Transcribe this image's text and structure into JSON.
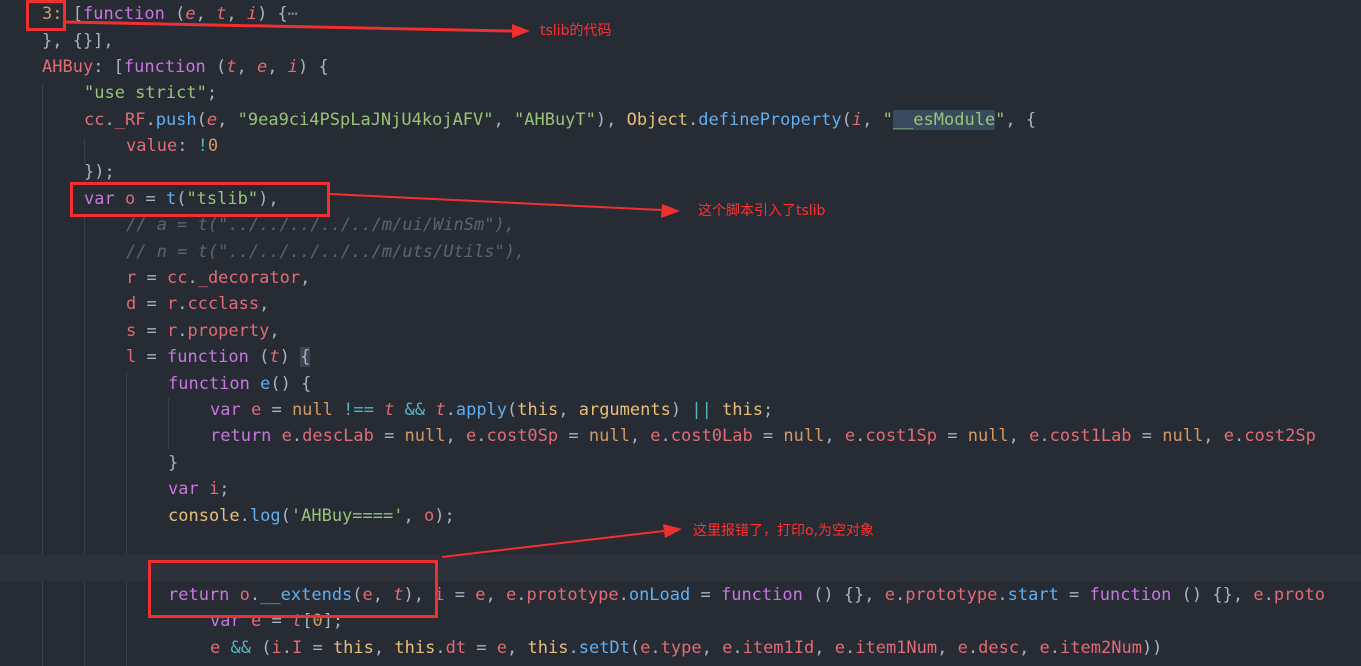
{
  "code_lines": [
    "3: [function (e, t, i) {⋯",
    "}, {}],",
    "AHBuy: [function (t, e, i) {",
    "\"use strict\";",
    "cc._RF.push(e, \"9ea9ci4PSpLaJNjU4kojAFV\", \"AHBuyT\"), Object.defineProperty(i, \"__esModule\", {",
    "value: !0",
    "});",
    "var o = t(\"tslib\"),",
    "// a = t(\"../../../../../m/ui/WinSm\"),",
    "// n = t(\"../../../../../m/uts/Utils\"),",
    "r = cc._decorator,",
    "d = r.ccclass,",
    "s = r.property,",
    "l = function (t) {",
    "function e() {",
    "var e = null !== t && t.apply(this, arguments) || this;",
    "return e.descLab = null, e.cost0Sp = null, e.cost0Lab = null, e.cost1Sp = null, e.cost1Lab = null, e.cost2Sp",
    "}",
    "var i;",
    "console.log('AHBuy====', o);",
    "",
    "return o.__extends(e, t), i = e, e.prototype.onLoad = function () {}, e.prototype.start = function () {}, e.proto",
    "var e = t[0];",
    "e && (i.I = this, this.dt = e, this.setDt(e.type, e.item1Id, e.item1Num, e.desc, e.item2Num))"
  ],
  "annotations": {
    "tslib_code": "tslib的代码",
    "script_imports_tslib": "这个脚本引入了tslib",
    "error_here": "这里报错了，打印o,为空对象"
  },
  "colors": {
    "background": "#272b34",
    "keyword": "#c678dd",
    "function": "#61afef",
    "string": "#98c379",
    "property": "#e06c75",
    "comment": "#5c6370",
    "annotation": "#f03030"
  }
}
